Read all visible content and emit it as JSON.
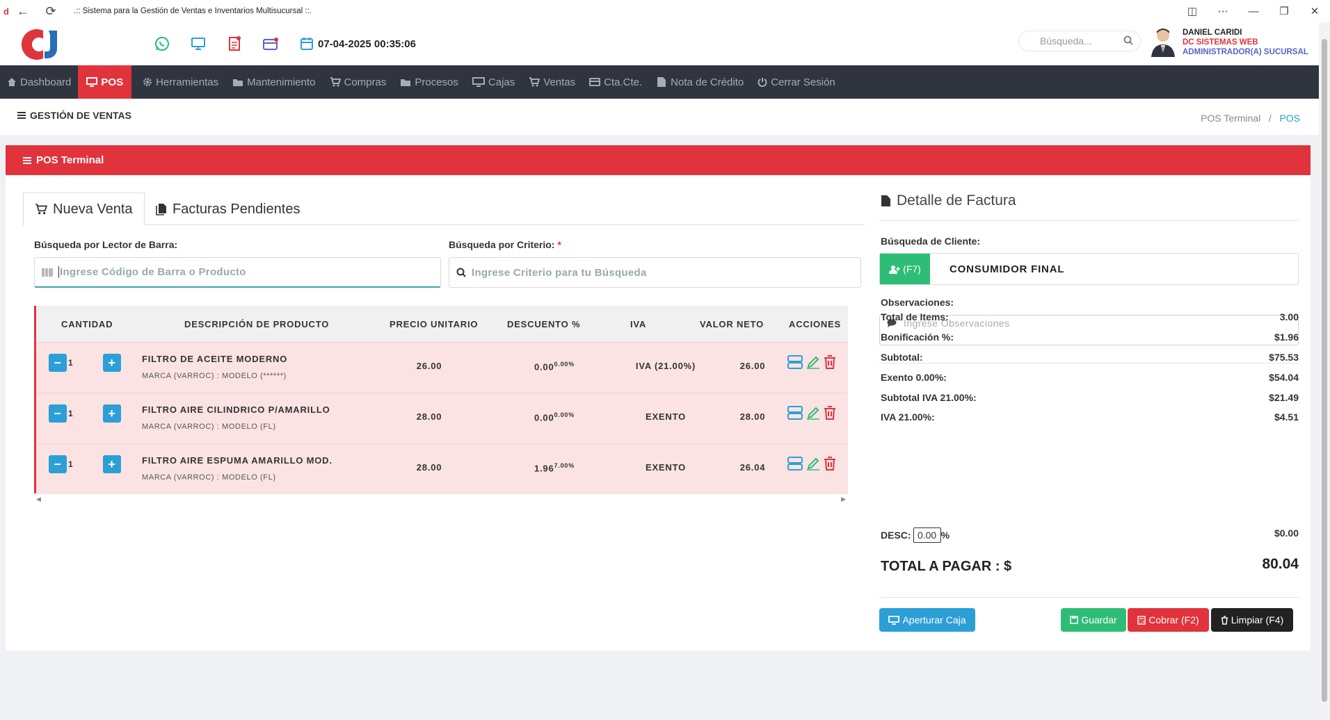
{
  "browser": {
    "title": ".:: Sistema para la Gestión de Ventas e Inventarios Multisucursal ::."
  },
  "header": {
    "datetime": "07-04-2025 00:35:06",
    "search_placeholder": "Búsqueda...",
    "user": {
      "name": "DANIEL CARIDI",
      "company": "DC SISTEMAS WEB",
      "role": "ADMINISTRADOR(A) SUCURSAL"
    }
  },
  "menu": [
    "Dashboard",
    "POS",
    "Herramientas",
    "Mantenimiento",
    "Compras",
    "Procesos",
    "Cajas",
    "Ventas",
    "Cta.Cte.",
    "Nota de Crédito",
    "Cerrar Sesión"
  ],
  "section": {
    "title": "GESTIÓN DE VENTAS",
    "breadcrumb": [
      "POS Terminal",
      "POS"
    ]
  },
  "card": {
    "title": "POS Terminal"
  },
  "tabs": [
    "Nueva Venta",
    "Facturas Pendientes"
  ],
  "search": {
    "barcode_label": "Búsqueda por Lector de Barra:",
    "barcode_placeholder": "Ingrese Código de Barra o Producto",
    "criteria_label": "Búsqueda por Criterio:",
    "required_mark": "*",
    "criteria_placeholder": "Ingrese Criterio para tu Búsqueda"
  },
  "table": {
    "headers": [
      "CANTIDAD",
      "DESCRIPCIÓN DE PRODUCTO",
      "PRECIO UNITARIO",
      "DESCUENTO %",
      "IVA",
      "VALOR NETO",
      "ACCIONES"
    ],
    "rows": [
      {
        "qty": "1",
        "name": "FILTRO DE ACEITE MODERNO",
        "detail": "MARCA (VARROC) : MODELO (******)",
        "price": "26.00",
        "discount": "0.00",
        "discount_pct": "0.00%",
        "iva": "IVA (21.00%)",
        "net": "26.00"
      },
      {
        "qty": "1",
        "name": "FILTRO AIRE CILINDRICO P/AMARILLO",
        "detail": "MARCA (VARROC) : MODELO (FL)",
        "price": "28.00",
        "discount": "0.00",
        "discount_pct": "0.00%",
        "iva": "EXENTO",
        "net": "28.00"
      },
      {
        "qty": "1",
        "name": "FILTRO AIRE ESPUMA AMARILLO MOD.",
        "detail": "MARCA (VARROC) : MODELO (FL)",
        "price": "28.00",
        "discount": "1.96",
        "discount_pct": "7.00%",
        "iva": "EXENTO",
        "net": "26.04"
      }
    ]
  },
  "invoice": {
    "title": "Detalle de Factura",
    "client_label": "Búsqueda de Cliente:",
    "client_btn": "(F7)",
    "client_value": "CONSUMIDOR FINAL",
    "obs_label": "Observaciones:",
    "obs_placeholder": "Ingrese Observaciones",
    "summary": [
      {
        "k": "Total de Items:",
        "v": "3.00"
      },
      {
        "k": "Bonificación %:",
        "v": "$1.96"
      },
      {
        "k": "Subtotal:",
        "v": "$75.53"
      },
      {
        "k": "Exento 0.00%:",
        "v": "$54.04"
      },
      {
        "k": "Subtotal IVA 21.00%:",
        "v": "$21.49"
      },
      {
        "k": "IVA 21.00%:",
        "v": "$4.51"
      }
    ],
    "desc_label": "DESC:",
    "desc_value": "0.00",
    "desc_unit": "%",
    "desc_amount": "$0.00",
    "total_label": "TOTAL A PAGAR : $",
    "total_value": "80.04"
  },
  "buttons": {
    "open_box": "Aperturar Caja",
    "save": "Guardar",
    "charge": "Cobrar (F2)",
    "clear": "Limpiar (F4)"
  },
  "colors": {
    "accent": "#e0333b",
    "menu_bg": "#30343f",
    "blue": "#2c9fd6",
    "green": "#2ebd76",
    "dark": "#222"
  }
}
